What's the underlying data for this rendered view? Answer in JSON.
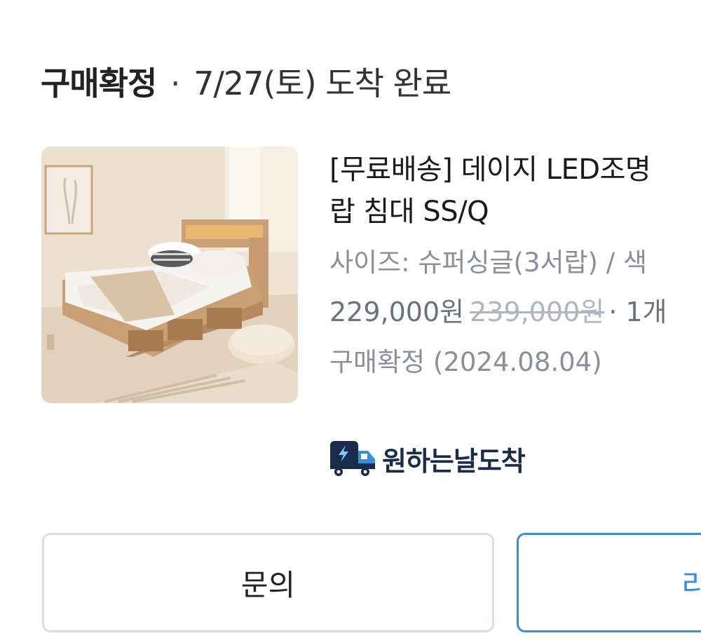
{
  "order_status": {
    "title": "구매확정",
    "separator": "·",
    "delivery": "7/27(토) 도착 완료"
  },
  "product": {
    "image_alt": "bed-photo",
    "title_line1": "[무료배송] 데이지 LED조명",
    "title_line2": "랍 침대 SS/Q",
    "option": "사이즈: 슈퍼싱글(3서랍) / 색",
    "price": "229,000원",
    "original_price": "239,000원",
    "quantity": "· 1개",
    "confirm_label": "구매확정 (2024.08.04)",
    "delivery_badge": {
      "icon": "delivery-truck-icon",
      "label": "원하는날도착"
    }
  },
  "buttons": {
    "inquiry": "문의",
    "review": "리뷰 작성"
  },
  "colors": {
    "accent_blue": "#3a8edb",
    "badge_navy": "#1b2b4a",
    "muted_text": "#8a8f99"
  }
}
